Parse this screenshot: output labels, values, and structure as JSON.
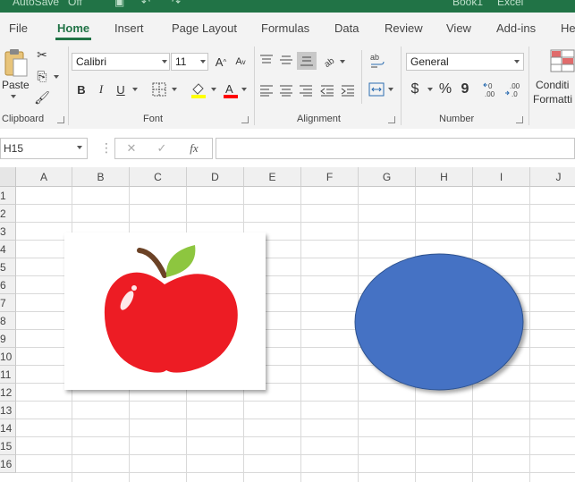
{
  "title_bar": {
    "autosave_label": "AutoSave",
    "autosave_state": "Off",
    "book_name": "Book1",
    "app_name": "Excel"
  },
  "tabs": [
    "File",
    "Home",
    "Insert",
    "Page Layout",
    "Formulas",
    "Data",
    "Review",
    "View",
    "Add-ins",
    "He"
  ],
  "active_tab": "Home",
  "ribbon": {
    "clipboard": {
      "paste_label": "Paste",
      "group_label": "Clipboard"
    },
    "font": {
      "font_name": "Calibri",
      "font_size": "11",
      "bold": "B",
      "italic": "I",
      "underline": "U",
      "increase": "A",
      "decrease": "A",
      "group_label": "Font",
      "fill_color": "#ffff00",
      "font_color": "#ff0000"
    },
    "alignment": {
      "group_label": "Alignment"
    },
    "number": {
      "format": "General",
      "currency": "$",
      "percent": "%",
      "comma": "9",
      "group_label": "Number"
    },
    "styles": {
      "conditional_label_1": "Conditi",
      "conditional_label_2": "Formatti"
    }
  },
  "formula_bar": {
    "name_box": "H15",
    "cancel": "✕",
    "enter": "✓",
    "fx": "fx",
    "formula": ""
  },
  "grid": {
    "columns": [
      "A",
      "B",
      "C",
      "D",
      "E",
      "F",
      "G",
      "H",
      "I",
      "J"
    ],
    "rows": [
      "1",
      "2",
      "3",
      "4",
      "5",
      "6",
      "7",
      "8",
      "9",
      "10",
      "11",
      "12",
      "13",
      "14",
      "15",
      "16"
    ]
  },
  "shapes": {
    "apple_colors": {
      "body": "#ed1c24",
      "leaf": "#8dc63f",
      "stem": "#6b4226"
    },
    "oval_color": "#4472c4",
    "oval_border": "#2f528f"
  },
  "colors": {
    "accent": "#217346"
  }
}
